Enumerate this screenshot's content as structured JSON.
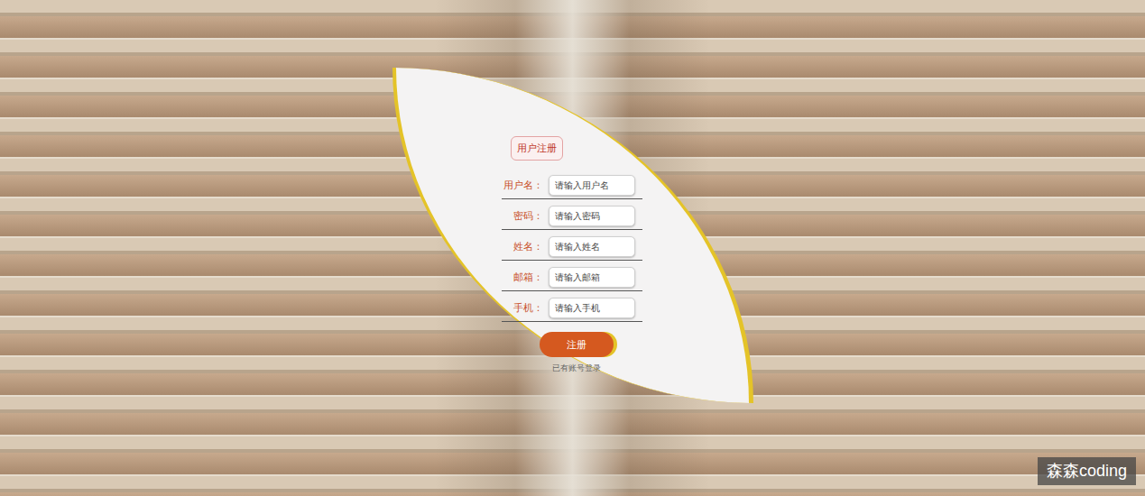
{
  "form": {
    "title": "用户注册",
    "fields": [
      {
        "label": "用户名：",
        "placeholder": "请输入用户名"
      },
      {
        "label": "密码：",
        "placeholder": "请输入密码"
      },
      {
        "label": "姓名：",
        "placeholder": "请输入姓名"
      },
      {
        "label": "邮箱：",
        "placeholder": "请输入邮箱"
      },
      {
        "label": "手机：",
        "placeholder": "请输入手机"
      }
    ],
    "button": "注册",
    "link": "已有账号登录"
  },
  "watermark": "森森coding"
}
